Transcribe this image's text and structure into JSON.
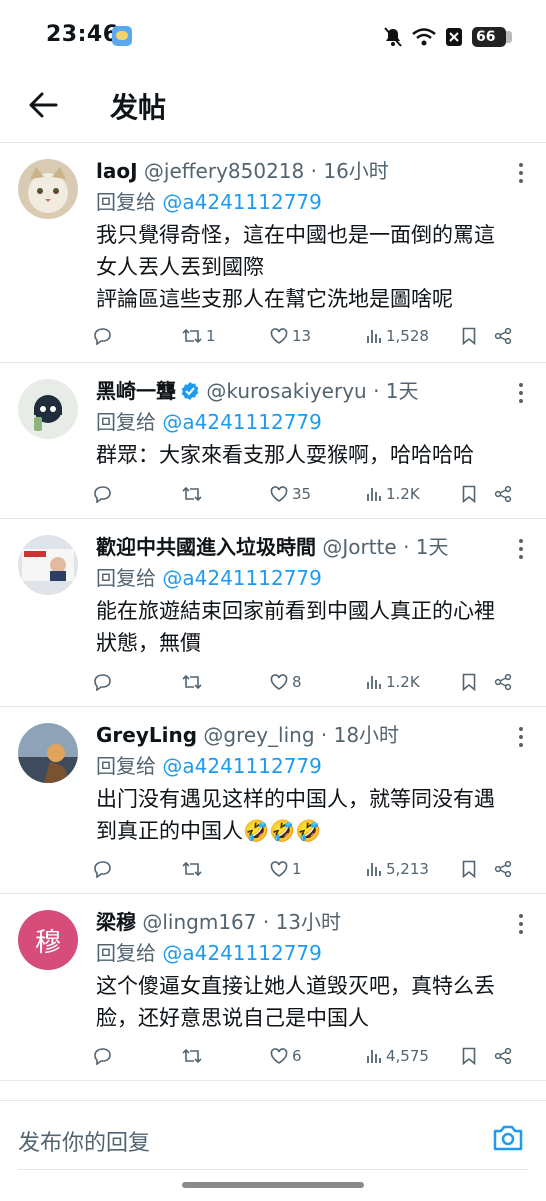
{
  "status_bar": {
    "time": "23:46",
    "battery": "66"
  },
  "header": {
    "title": "发帖"
  },
  "replies": [
    {
      "name": "laoJ",
      "handle": "@jeffery850218",
      "time": "· 16小时",
      "reply_prefix": "回复给",
      "reply_to": "@a4241112779",
      "text_lines": [
        "我只覺得奇怪，這在中國也是一面倒的罵這",
        "女人丟人丟到國際",
        "評論區這些支那人在幫它洗地是圖啥呢"
      ],
      "retweets": "1",
      "likes": "13",
      "views": "1,528",
      "verified": false
    },
    {
      "name": "黑崎一聾",
      "handle": "@kurosakiyeryu",
      "time": "· 1天",
      "reply_prefix": "回复给",
      "reply_to": "@a4241112779",
      "text_lines": [
        "群眾：大家來看支那人耍猴啊，哈哈哈哈"
      ],
      "retweets": "",
      "likes": "35",
      "views": "1.2K",
      "verified": true
    },
    {
      "name": "歡迎中共國進入垃圾時間",
      "handle": "@Jortte",
      "time": "· 1天",
      "reply_prefix": "回复给",
      "reply_to": "@a4241112779",
      "text_lines": [
        "能在旅遊結束回家前看到中國人真正的心裡",
        "狀態，無價"
      ],
      "retweets": "",
      "likes": "8",
      "views": "1.2K",
      "verified": false
    },
    {
      "name": "GreyLing",
      "handle": "@grey_ling",
      "time": "· 18小时",
      "reply_prefix": "回复给",
      "reply_to": "@a4241112779",
      "text_lines": [
        "出门没有遇见这样的中国人，就等同没有遇",
        "到真正的中国人🤣🤣🤣"
      ],
      "retweets": "",
      "likes": "1",
      "views": "5,213",
      "verified": false
    },
    {
      "name": "梁穆",
      "handle": "@lingm167",
      "time": "· 13小时",
      "reply_prefix": "回复给",
      "reply_to": "@a4241112779",
      "text_lines": [
        "这个傻逼女直接让她人道毁灭吧，真特么丢",
        "脸，还好意思说自己是中国人"
      ],
      "retweets": "",
      "likes": "6",
      "views": "4,575",
      "verified": false,
      "avatar_letter": "穆"
    }
  ],
  "composer": {
    "placeholder": "发布你的回复"
  },
  "icons": [
    "back-arrow-icon",
    "more-icon",
    "reply-icon",
    "retweet-icon",
    "like-icon",
    "views-icon",
    "bookmark-icon",
    "share-icon",
    "camera-icon",
    "verified-icon"
  ],
  "colors": {
    "link": "#1d9bf0",
    "muted": "#536471",
    "avatar_letter_bg": "#d64d7a"
  }
}
